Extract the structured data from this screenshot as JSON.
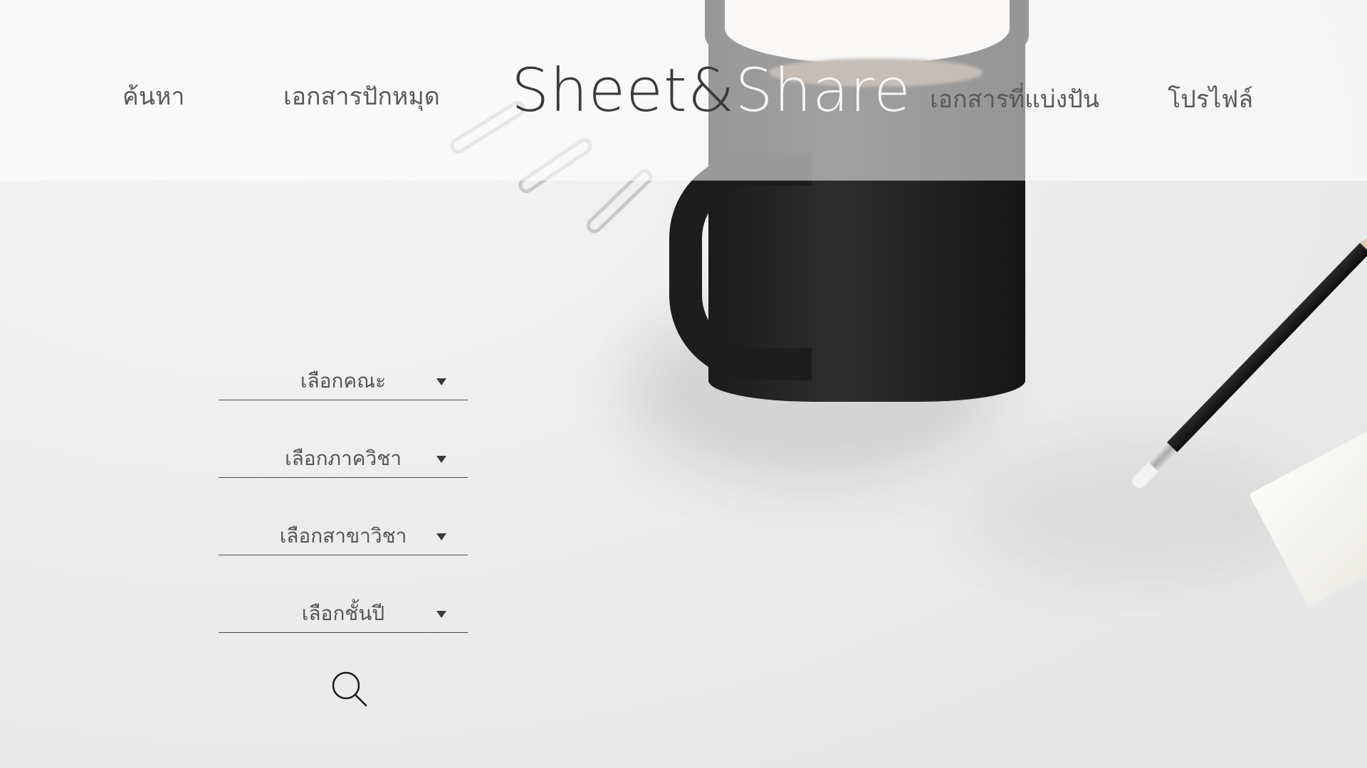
{
  "nav": {
    "search": "ค้นหา",
    "pinned_docs": "เอกสารปักหมุด",
    "shared_docs": "เอกสารที่แบ่งปัน",
    "profile": "โปรไฟล์"
  },
  "logo": {
    "part1": "Sheet",
    "amp": "&",
    "part2": "Share"
  },
  "filters": [
    {
      "label": "เลือกคณะ"
    },
    {
      "label": "เลือกภาควิชา"
    },
    {
      "label": "เลือกสาขาวิชา"
    },
    {
      "label": "เลือกชั้นปี"
    }
  ],
  "icons": {
    "caret": "caret-down-icon",
    "search": "search-icon"
  },
  "colors": {
    "header_overlay": "#ffffff",
    "text": "#5a5a5a",
    "logo_dark": "#3b3b3b",
    "logo_light": "#f4f4f4"
  }
}
